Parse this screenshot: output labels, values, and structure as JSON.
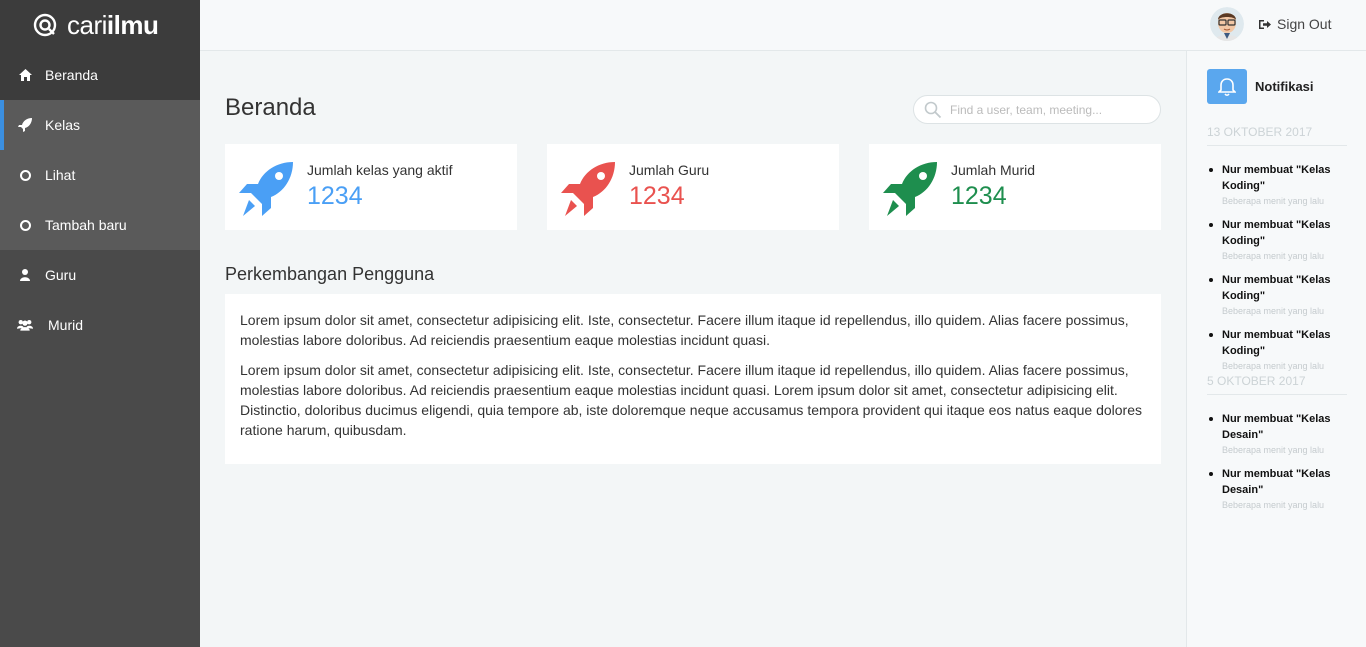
{
  "brand": {
    "name_light": "cari",
    "name_bold": "ilmu"
  },
  "sidebar": {
    "items": [
      {
        "label": "Beranda",
        "icon": "home-icon"
      },
      {
        "label": "Kelas",
        "icon": "rocket-icon"
      },
      {
        "label": "Lihat",
        "icon": "circle-icon"
      },
      {
        "label": "Tambah baru",
        "icon": "circle-icon"
      },
      {
        "label": "Guru",
        "icon": "user-icon"
      },
      {
        "label": "Murid",
        "icon": "users-icon"
      }
    ]
  },
  "header": {
    "signout_label": "Sign Out"
  },
  "main": {
    "title": "Beranda",
    "search_placeholder": "Find a user, team, meeting...",
    "stats": [
      {
        "label": "Jumlah kelas yang aktif",
        "value": "1234",
        "color": "#4a9ff5"
      },
      {
        "label": "Jumlah Guru",
        "value": "1234",
        "color": "#e9524f"
      },
      {
        "label": "Jumlah Murid",
        "value": "1234",
        "color": "#1e8e4e"
      }
    ],
    "section_title": "Perkembangan Pengguna",
    "paragraphs": [
      "Lorem ipsum dolor sit amet, consectetur adipisicing elit. Iste, consectetur. Facere illum itaque id repellendus, illo quidem. Alias facere possimus, molestias labore doloribus. Ad reiciendis praesentium eaque molestias incidunt quasi.",
      "Lorem ipsum dolor sit amet, consectetur adipisicing elit. Iste, consectetur. Facere illum itaque id repellendus, illo quidem. Alias facere possimus, molestias labore doloribus. Ad reiciendis praesentium eaque molestias incidunt quasi. Lorem ipsum dolor sit amet, consectetur adipisicing elit. Distinctio, doloribus ducimus eligendi, quia tempore ab, iste doloremque neque accusamus tempora provident qui itaque eos natus eaque dolores ratione harum, quibusdam."
    ]
  },
  "notifications": {
    "title": "Notifikasi",
    "groups": [
      {
        "date": "13 OKTOBER 2017",
        "items": [
          {
            "msg": "Nur membuat \"Kelas Koding\"",
            "time": "Beberapa menit yang lalu"
          },
          {
            "msg": "Nur membuat \"Kelas Koding\"",
            "time": "Beberapa menit yang lalu"
          },
          {
            "msg": "Nur membuat \"Kelas Koding\"",
            "time": "Beberapa menit yang lalu"
          },
          {
            "msg": "Nur membuat \"Kelas Koding\"",
            "time": "Beberapa menit yang lalu"
          }
        ]
      },
      {
        "date": "5 OKTOBER 2017",
        "items": [
          {
            "msg": "Nur membuat \"Kelas Desain\"",
            "time": "Beberapa menit yang lalu"
          },
          {
            "msg": "Nur membuat \"Kelas Desain\"",
            "time": "Beberapa menit yang lalu"
          }
        ]
      }
    ]
  }
}
